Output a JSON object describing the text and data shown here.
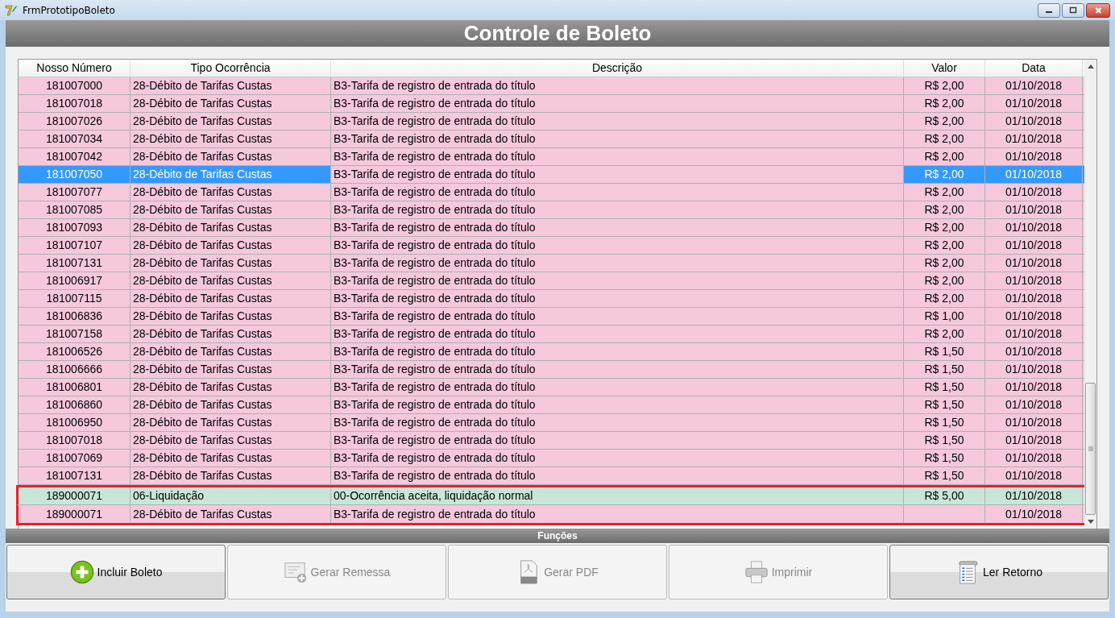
{
  "window": {
    "title": "FrmPrototipoBoleto"
  },
  "header": {
    "title": "Controle de Boleto"
  },
  "table": {
    "columns": [
      "Nosso Número",
      "Tipo Ocorrência",
      "Descrição",
      "Valor",
      "Data"
    ],
    "rows": [
      {
        "cells": [
          "181007000",
          "28-Débito de Tarifas Custas",
          "B3-Tarifa de registro de entrada do título",
          "R$ 2,00",
          "01/10/2018"
        ],
        "color": "#f5c8dc",
        "selected": false,
        "highlighted": false
      },
      {
        "cells": [
          "181007018",
          "28-Débito de Tarifas Custas",
          "B3-Tarifa de registro de entrada do título",
          "R$ 2,00",
          "01/10/2018"
        ],
        "color": "#f5c8dc",
        "selected": false,
        "highlighted": false
      },
      {
        "cells": [
          "181007026",
          "28-Débito de Tarifas Custas",
          "B3-Tarifa de registro de entrada do título",
          "R$ 2,00",
          "01/10/2018"
        ],
        "color": "#f5c8dc",
        "selected": false,
        "highlighted": false
      },
      {
        "cells": [
          "181007034",
          "28-Débito de Tarifas Custas",
          "B3-Tarifa de registro de entrada do título",
          "R$ 2,00",
          "01/10/2018"
        ],
        "color": "#f5c8dc",
        "selected": false,
        "highlighted": false
      },
      {
        "cells": [
          "181007042",
          "28-Débito de Tarifas Custas",
          "B3-Tarifa de registro de entrada do título",
          "R$ 2,00",
          "01/10/2018"
        ],
        "color": "#f5c8dc",
        "selected": false,
        "highlighted": false
      },
      {
        "cells": [
          "181007050",
          "28-Débito de Tarifas Custas",
          "B3-Tarifa de registro de entrada do título",
          "R$ 2,00",
          "01/10/2018"
        ],
        "color": "#f5c8dc",
        "selected": true,
        "highlighted": false
      },
      {
        "cells": [
          "181007077",
          "28-Débito de Tarifas Custas",
          "B3-Tarifa de registro de entrada do título",
          "R$ 2,00",
          "01/10/2018"
        ],
        "color": "#f5c8dc",
        "selected": false,
        "highlighted": false
      },
      {
        "cells": [
          "181007085",
          "28-Débito de Tarifas Custas",
          "B3-Tarifa de registro de entrada do título",
          "R$ 2,00",
          "01/10/2018"
        ],
        "color": "#f5c8dc",
        "selected": false,
        "highlighted": false
      },
      {
        "cells": [
          "181007093",
          "28-Débito de Tarifas Custas",
          "B3-Tarifa de registro de entrada do título",
          "R$ 2,00",
          "01/10/2018"
        ],
        "color": "#f5c8dc",
        "selected": false,
        "highlighted": false
      },
      {
        "cells": [
          "181007107",
          "28-Débito de Tarifas Custas",
          "B3-Tarifa de registro de entrada do título",
          "R$ 2,00",
          "01/10/2018"
        ],
        "color": "#f5c8dc",
        "selected": false,
        "highlighted": false
      },
      {
        "cells": [
          "181007131",
          "28-Débito de Tarifas Custas",
          "B3-Tarifa de registro de entrada do título",
          "R$ 2,00",
          "01/10/2018"
        ],
        "color": "#f5c8dc",
        "selected": false,
        "highlighted": false
      },
      {
        "cells": [
          "181006917",
          "28-Débito de Tarifas Custas",
          "B3-Tarifa de registro de entrada do título",
          "R$ 2,00",
          "01/10/2018"
        ],
        "color": "#f5c8dc",
        "selected": false,
        "highlighted": false
      },
      {
        "cells": [
          "181007115",
          "28-Débito de Tarifas Custas",
          "B3-Tarifa de registro de entrada do título",
          "R$ 2,00",
          "01/10/2018"
        ],
        "color": "#f5c8dc",
        "selected": false,
        "highlighted": false
      },
      {
        "cells": [
          "181006836",
          "28-Débito de Tarifas Custas",
          "B3-Tarifa de registro de entrada do título",
          "R$ 1,00",
          "01/10/2018"
        ],
        "color": "#f5c8dc",
        "selected": false,
        "highlighted": false
      },
      {
        "cells": [
          "181007158",
          "28-Débito de Tarifas Custas",
          "B3-Tarifa de registro de entrada do título",
          "R$ 2,00",
          "01/10/2018"
        ],
        "color": "#f5c8dc",
        "selected": false,
        "highlighted": false
      },
      {
        "cells": [
          "181006526",
          "28-Débito de Tarifas Custas",
          "B3-Tarifa de registro de entrada do título",
          "R$ 1,50",
          "01/10/2018"
        ],
        "color": "#f5c8dc",
        "selected": false,
        "highlighted": false
      },
      {
        "cells": [
          "181006666",
          "28-Débito de Tarifas Custas",
          "B3-Tarifa de registro de entrada do título",
          "R$ 1,50",
          "01/10/2018"
        ],
        "color": "#f5c8dc",
        "selected": false,
        "highlighted": false
      },
      {
        "cells": [
          "181006801",
          "28-Débito de Tarifas Custas",
          "B3-Tarifa de registro de entrada do título",
          "R$ 1,50",
          "01/10/2018"
        ],
        "color": "#f5c8dc",
        "selected": false,
        "highlighted": false
      },
      {
        "cells": [
          "181006860",
          "28-Débito de Tarifas Custas",
          "B3-Tarifa de registro de entrada do título",
          "R$ 1,50",
          "01/10/2018"
        ],
        "color": "#f5c8dc",
        "selected": false,
        "highlighted": false
      },
      {
        "cells": [
          "181006950",
          "28-Débito de Tarifas Custas",
          "B3-Tarifa de registro de entrada do título",
          "R$ 1,50",
          "01/10/2018"
        ],
        "color": "#f5c8dc",
        "selected": false,
        "highlighted": false
      },
      {
        "cells": [
          "181007018",
          "28-Débito de Tarifas Custas",
          "B3-Tarifa de registro de entrada do título",
          "R$ 1,50",
          "01/10/2018"
        ],
        "color": "#f5c8dc",
        "selected": false,
        "highlighted": false
      },
      {
        "cells": [
          "181007069",
          "28-Débito de Tarifas Custas",
          "B3-Tarifa de registro de entrada do título",
          "R$ 1,50",
          "01/10/2018"
        ],
        "color": "#f5c8dc",
        "selected": false,
        "highlighted": false
      },
      {
        "cells": [
          "181007131",
          "28-Débito de Tarifas Custas",
          "B3-Tarifa de registro de entrada do título",
          "R$ 1,50",
          "01/10/2018"
        ],
        "color": "#f5c8dc",
        "selected": false,
        "highlighted": false
      },
      {
        "cells": [
          "189000071",
          "06-Liquidação",
          "00-Ocorrência aceita, liquidação normal",
          "R$ 5,00",
          "01/10/2018"
        ],
        "color": "#c8e6d8",
        "selected": false,
        "highlighted": true
      },
      {
        "cells": [
          "189000071",
          "28-Débito de Tarifas Custas",
          "B3-Tarifa de registro de entrada do título",
          "",
          "01/10/2018"
        ],
        "color": "#f5c8dc",
        "selected": false,
        "highlighted": true
      }
    ]
  },
  "functions": {
    "title": "Funções",
    "buttons": [
      {
        "label": "Incluir Boleto",
        "kind": "add",
        "disabled": false
      },
      {
        "label": "Gerar Remessa",
        "kind": "remittance",
        "disabled": true
      },
      {
        "label": "Gerar PDF",
        "kind": "pdf",
        "disabled": true
      },
      {
        "label": "Imprimir",
        "kind": "print",
        "disabled": true
      },
      {
        "label": "Ler Retorno",
        "kind": "return",
        "disabled": false
      }
    ]
  }
}
